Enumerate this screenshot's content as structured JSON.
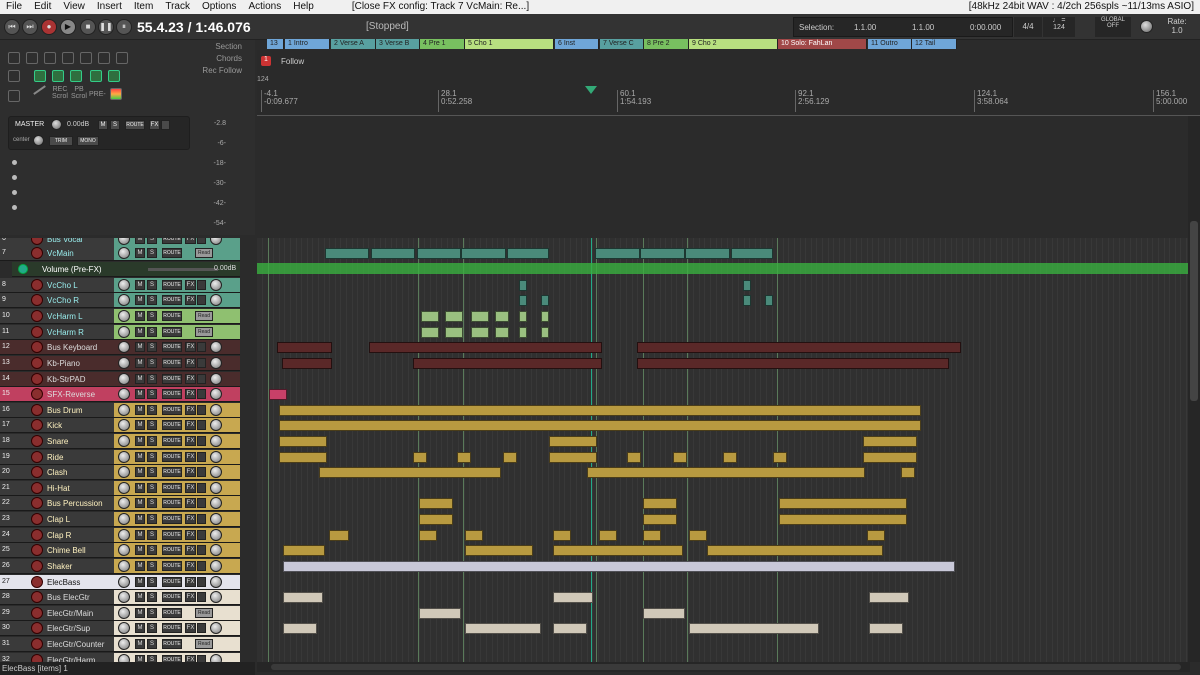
{
  "menu": [
    "File",
    "Edit",
    "View",
    "Insert",
    "Item",
    "Track",
    "Options",
    "Actions",
    "Help"
  ],
  "window_title": "[Close FX config: Track 7 VcMain: Re...]",
  "audio_status": "[48kHz 24bit WAV : 4/2ch 256spls ~11/13ms ASIO]",
  "transport": {
    "time": "55.4.23 / 1:46.076",
    "state": "[Stopped]",
    "selection_label": "Selection:",
    "sel_start": "1.1.00",
    "sel_end": "1.1.00",
    "sel_len": "0:00.000",
    "timesig": "4/4",
    "bpm": "124",
    "global_label": "GLOBAL",
    "global_state": "OFF",
    "rate_label": "Rate:",
    "rate_value": "1.0"
  },
  "left": {
    "section": "Section",
    "chords": "Chords",
    "rec_follow": "Rec Follow",
    "follow": "Follow",
    "follow_num": "1",
    "rec_scroll": "REC Scrol",
    "pb_scroll": "PB Scrol",
    "pre": "PRE-",
    "master": "MASTER",
    "master_vol": "0.00dB",
    "center": "center",
    "trim": "TRIM",
    "mono": "MONO",
    "tempo_marker": "124"
  },
  "meter_scale": [
    "-2.8",
    "-6-",
    "-18-",
    "-30-",
    "-42-",
    "-54-"
  ],
  "regions": [
    {
      "label": "13",
      "color": "#6fa6d8"
    },
    {
      "label": "1 Intro",
      "color": "#6fa6d8"
    },
    {
      "label": "2 Verse A",
      "color": "#58a0a0"
    },
    {
      "label": "3 Verse B",
      "color": "#58a0a0"
    },
    {
      "label": "4 Pre 1",
      "color": "#78c060"
    },
    {
      "label": "5 Cho 1",
      "color": "#b8e080"
    },
    {
      "label": "6 Inst",
      "color": "#6fa6d8"
    },
    {
      "label": "7 Verse C",
      "color": "#58a0a0"
    },
    {
      "label": "8 Pre 2",
      "color": "#78c060"
    },
    {
      "label": "9 Cho 2",
      "color": "#b8e080"
    },
    {
      "label": "10 Solo: FahLan",
      "color": "#a04848"
    },
    {
      "label": "11 Outro",
      "color": "#6fa6d8"
    },
    {
      "label": "12 Tail",
      "color": "#6fa6d8"
    }
  ],
  "ruler": [
    {
      "bar": "-4.1",
      "time": "-0:09.677"
    },
    {
      "bar": "28.1",
      "time": "0:52.258"
    },
    {
      "bar": "60.1",
      "time": "1:54.193"
    },
    {
      "bar": "92.1",
      "time": "2:56.129"
    },
    {
      "bar": "124.1",
      "time": "3:58.064"
    },
    {
      "bar": "156.1",
      "time": "5:00.000"
    }
  ],
  "envelope_label": "Volume (Pre-FX)",
  "envelope_value": "0.00dB",
  "tracks": [
    {
      "num": "6",
      "name": "Bus Vocal",
      "color": "#5aa08a"
    },
    {
      "num": "7",
      "name": "VcMain",
      "color": "#5aa08a"
    },
    {
      "num": "8",
      "name": "VcCho L",
      "color": "#5aa08a"
    },
    {
      "num": "9",
      "name": "VcCho R",
      "color": "#5aa08a"
    },
    {
      "num": "10",
      "name": "VcHarm L",
      "color": "#8fc070"
    },
    {
      "num": "11",
      "name": "VcHarm R",
      "color": "#8fc070"
    },
    {
      "num": "12",
      "name": "Bus Keyboard",
      "color": "#5a3030"
    },
    {
      "num": "13",
      "name": "Kb-Piano",
      "color": "#5a3030"
    },
    {
      "num": "14",
      "name": "Kb-StrPAD",
      "color": "#5a3030"
    },
    {
      "num": "15",
      "name": "SFX-Reverse",
      "color": "#c04060"
    },
    {
      "num": "16",
      "name": "Bus Drum",
      "color": "#c8a850"
    },
    {
      "num": "17",
      "name": "Kick",
      "color": "#c8a850"
    },
    {
      "num": "18",
      "name": "Snare",
      "color": "#c8a850"
    },
    {
      "num": "19",
      "name": "Ride",
      "color": "#c8a850"
    },
    {
      "num": "20",
      "name": "Clash",
      "color": "#c8a850"
    },
    {
      "num": "21",
      "name": "Hi-Hat",
      "color": "#c8a850"
    },
    {
      "num": "22",
      "name": "Bus Percussion",
      "color": "#c8a850"
    },
    {
      "num": "23",
      "name": "Clap L",
      "color": "#c8a850"
    },
    {
      "num": "24",
      "name": "Clap R",
      "color": "#c8a850"
    },
    {
      "num": "25",
      "name": "Chime Bell",
      "color": "#c8a850"
    },
    {
      "num": "26",
      "name": "Shaker",
      "color": "#c8a850"
    },
    {
      "num": "27",
      "name": "ElecBass",
      "color": "#d8d8e8"
    },
    {
      "num": "28",
      "name": "Bus ElecGtr",
      "color": "#e8e0d0"
    },
    {
      "num": "29",
      "name": "ElecGtr/Main",
      "color": "#e8e0d0"
    },
    {
      "num": "30",
      "name": "ElecGtr/Sup",
      "color": "#e8e0d0"
    },
    {
      "num": "31",
      "name": "ElecGtr/Counter",
      "color": "#e8e0d0"
    },
    {
      "num": "32",
      "name": "ElecGtr/Harm",
      "color": "#e8e0d0"
    }
  ],
  "button_labels": {
    "m": "M",
    "s": "S",
    "route": "ROUTE",
    "fx": "FX",
    "read": "Read"
  },
  "status": "ElecBass [items] 1"
}
